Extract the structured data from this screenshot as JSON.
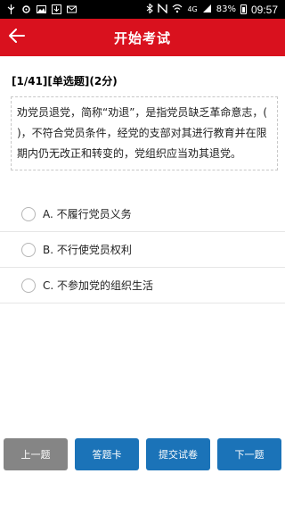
{
  "status_bar": {
    "battery": "83%",
    "network": "4G",
    "time": "09:57",
    "left_icons": [
      "usb-icon",
      "settings-icon",
      "image-icon",
      "download-icon",
      "mail-icon"
    ],
    "right_icons": [
      "bluetooth-icon",
      "nfc-icon",
      "wifi-icon",
      "signal-icon",
      "battery-icon"
    ]
  },
  "header": {
    "title": "开始考试",
    "back_icon": "back-arrow-icon",
    "bg_color": "#d9111e"
  },
  "question": {
    "meta": "[1/41][单选题](2分)",
    "text": "劝党员退党，简称“劝退”，是指党员缺乏革命意志，( )，不符合党员条件，经党的支部对其进行教育并在限期内仍无改正和转变的，党组织应当劝其退党。"
  },
  "options": [
    {
      "label": "A.  不履行党员义务"
    },
    {
      "label": "B.  不行使党员权利"
    },
    {
      "label": "C.  不参加党的组织生活"
    }
  ],
  "buttons": {
    "prev": "上一题",
    "answer_card": "答题卡",
    "submit": "提交试卷",
    "next": "下一题"
  },
  "colors": {
    "primary": "#1b73b8",
    "disabled": "#858585"
  }
}
